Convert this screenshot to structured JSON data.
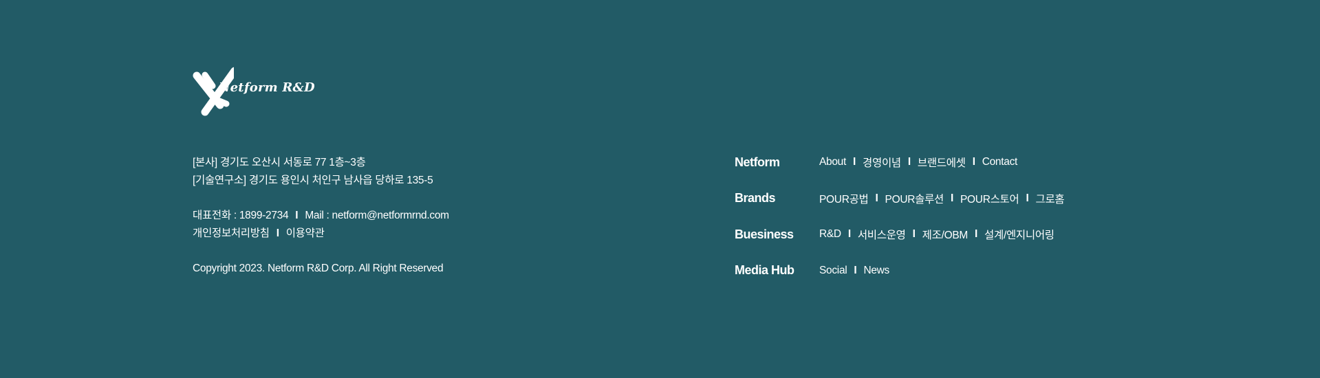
{
  "logo": {
    "text": "Netform R&D"
  },
  "company": {
    "hq_address": "[본사] 경기도 오산시 서동로 77 1층~3층",
    "lab_address": "[기술연구소] 경기도 용인시 처인구 남사읍 당하로 135-5",
    "phone": "대표전화 : 1899-2734",
    "separator": "I",
    "mail": "Mail : netform@netformrnd.com",
    "privacy_link": "개인정보처리방침",
    "terms_link": "이용약관",
    "copyright": "Copyright 2023. Netform R&D Corp. All Right Reserved"
  },
  "nav": {
    "separator": "I",
    "sections": [
      {
        "title": "Netform",
        "links": [
          "About",
          "경영이념",
          "브랜드에셋",
          "Contact"
        ]
      },
      {
        "title": "Brands",
        "links": [
          "POUR공법",
          "POUR솔루션",
          "POUR스토어",
          "그로홈"
        ]
      },
      {
        "title": "Buesiness",
        "links": [
          "R&D",
          "서비스운영",
          "제조/OBM",
          "설계/엔지니어링"
        ]
      },
      {
        "title": "Media Hub",
        "links": [
          "Social",
          "News"
        ]
      }
    ]
  },
  "colors": {
    "background": "#225b66",
    "text": "#ffffff"
  }
}
